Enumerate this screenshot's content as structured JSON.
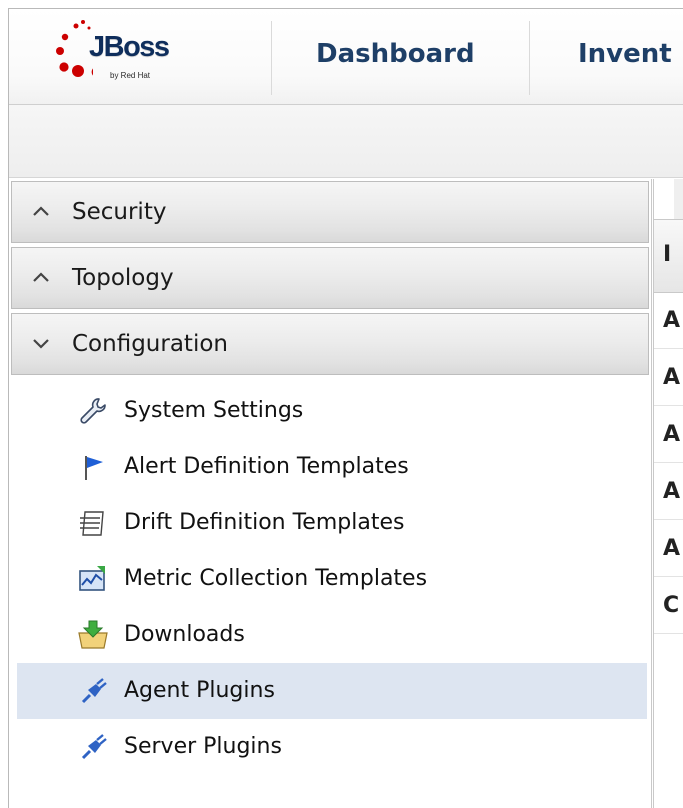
{
  "header": {
    "logo": {
      "brand": "JBoss",
      "subtitle": "by Red Hat",
      "dot_color": "#cc0000"
    },
    "nav_tabs": [
      {
        "label": "Dashboard"
      },
      {
        "label": "Invent"
      }
    ]
  },
  "leftnav": {
    "sections": [
      {
        "label": "Security",
        "state": "collapsed",
        "icon": "chevron-up-icon"
      },
      {
        "label": "Topology",
        "state": "collapsed",
        "icon": "chevron-up-icon"
      },
      {
        "label": "Configuration",
        "state": "expanded",
        "icon": "chevron-down-icon"
      }
    ],
    "configuration_items": [
      {
        "label": "System Settings",
        "icon": "wrench-icon"
      },
      {
        "label": "Alert Definition Templates",
        "icon": "flag-icon"
      },
      {
        "label": "Drift Definition Templates",
        "icon": "document-icon"
      },
      {
        "label": "Metric Collection Templates",
        "icon": "chart-icon"
      },
      {
        "label": "Downloads",
        "icon": "download-folder-icon"
      },
      {
        "label": "Agent Plugins",
        "icon": "plug-icon",
        "selected": true
      },
      {
        "label": "Server Plugins",
        "icon": "plug-icon"
      }
    ],
    "selected_color": "#dde5f1"
  },
  "content": {
    "column_header": "I",
    "row_prefixes": [
      "A",
      "A",
      "A",
      "A",
      "A",
      "C"
    ]
  },
  "colors": {
    "nav_text": "#1e3f67",
    "logo_text": "#0f2e5c",
    "flag_blue": "#1f5fd6",
    "plug_blue": "#2f63c4"
  }
}
